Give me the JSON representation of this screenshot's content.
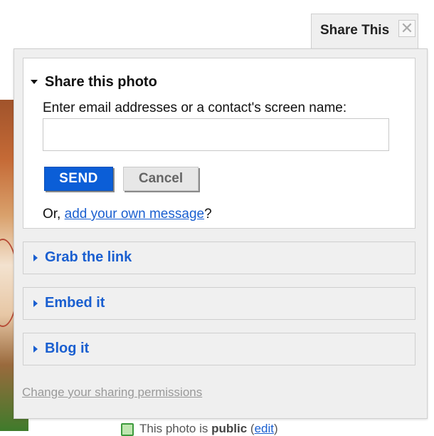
{
  "tab": {
    "title": "Share This",
    "close_symbol": "✕"
  },
  "share_photo": {
    "title": "Share this photo",
    "prompt": "Enter email addresses or a contact's screen name:",
    "email_value": "",
    "send_label": "SEND",
    "cancel_label": "Cancel",
    "message_prefix": "Or, ",
    "message_link": "add your own message",
    "message_suffix": "?"
  },
  "sections": {
    "link": "Grab the link",
    "embed": "Embed it",
    "blog": "Blog it"
  },
  "permissions_link": "Change your sharing permissions",
  "background": {
    "text_prefix": "This photo is ",
    "text_bold": "public",
    "text_open": " (",
    "text_link": "edit",
    "text_close": ")"
  },
  "colors": {
    "link_blue": "#1a5fd0",
    "send_blue": "#0b5ed7",
    "panel_gray": "#efefef"
  }
}
